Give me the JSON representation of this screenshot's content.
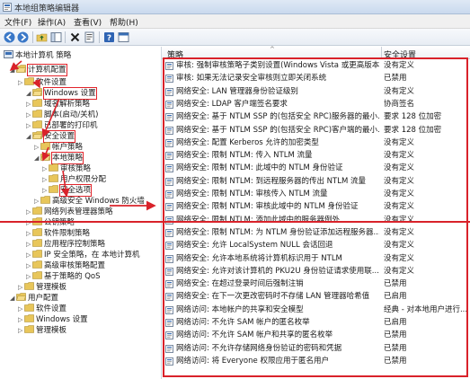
{
  "window": {
    "title": "本地组策略编辑器"
  },
  "menu": [
    "文件(F)",
    "操作(A)",
    "查看(V)",
    "帮助(H)"
  ],
  "toolbar": [
    "back-icon",
    "forward-icon",
    "up-folder-icon",
    "show-hide-tree-icon",
    "delete-icon",
    "properties-icon",
    "help-icon",
    "panel-icon"
  ],
  "tree": {
    "root": "本地计算机 策略",
    "nodes": [
      {
        "label": "计算机配置",
        "highlight": true
      },
      {
        "label": "软件设置"
      },
      {
        "label": "Windows 设置",
        "highlight": true
      },
      {
        "label": "域名解析策略"
      },
      {
        "label": "脚本(启动/关机)"
      },
      {
        "label": "已部署的打印机"
      },
      {
        "label": "安全设置",
        "highlight": true
      },
      {
        "label": "帐户策略"
      },
      {
        "label": "本地策略",
        "highlight": true
      },
      {
        "label": "审核策略"
      },
      {
        "label": "用户权限分配"
      },
      {
        "label": "安全选项",
        "highlight": true
      },
      {
        "label": "高级安全 Windows 防火墙"
      },
      {
        "label": "网络列表管理器策略"
      },
      {
        "label": "公钥策略"
      },
      {
        "label": "软件限制策略"
      },
      {
        "label": "应用程序控制策略"
      },
      {
        "label": "IP 安全策略，在 本地计算机"
      },
      {
        "label": "高级审核策略配置"
      },
      {
        "label": "基于策略的 QoS"
      },
      {
        "label": "管理模板"
      },
      {
        "label": "用户配置"
      },
      {
        "label": "软件设置"
      },
      {
        "label": "Windows 设置"
      },
      {
        "label": "管理模板"
      }
    ]
  },
  "list": {
    "col_policy": "策略",
    "col_setting": "安全设置",
    "rows": [
      {
        "name": "审核: 强制审核策略子类别设置(Windows Vista 或更高版本...",
        "value": "没有定义"
      },
      {
        "name": "审核: 如果无法记录安全审核则立即关闭系统",
        "value": "已禁用"
      },
      {
        "name": "网络安全: LAN 管理器身份验证级别",
        "value": "没有定义"
      },
      {
        "name": "网络安全: LDAP 客户端签名要求",
        "value": "协商签名"
      },
      {
        "name": "网络安全: 基于 NTLM SSP 的(包括安全 RPC)服务器的最小...",
        "value": "要求 128 位加密"
      },
      {
        "name": "网络安全: 基于 NTLM SSP 的(包括安全 RPC)客户端的最小...",
        "value": "要求 128 位加密"
      },
      {
        "name": "网络安全: 配置 Kerberos 允许的加密类型",
        "value": "没有定义"
      },
      {
        "name": "网络安全: 限制 NTLM: 传入 NTLM 流量",
        "value": "没有定义"
      },
      {
        "name": "网络安全: 限制 NTLM: 此域中的 NTLM 身份验证",
        "value": "没有定义"
      },
      {
        "name": "网络安全: 限制 NTLM: 到远程服务器的传出 NTLM 流量",
        "value": "没有定义"
      },
      {
        "name": "网络安全: 限制 NTLM: 审核传入 NTLM 流量",
        "value": "没有定义"
      },
      {
        "name": "网络安全: 限制 NTLM: 审核此域中的 NTLM 身份验证",
        "value": "没有定义"
      },
      {
        "name": "网络安全: 限制 NTLM: 添加此域中的服务器例外",
        "value": "没有定义"
      },
      {
        "name": "网络安全: 限制 NTLM: 为 NTLM 身份验证添加远程服务器...",
        "value": "没有定义"
      },
      {
        "name": "网络安全: 允许 LocalSystem NULL 会话回退",
        "value": "没有定义"
      },
      {
        "name": "网络安全: 允许本地系统将计算机标识用于 NTLM",
        "value": "没有定义"
      },
      {
        "name": "网络安全: 允许对该计算机的 PKU2U 身份验证请求使用联...",
        "value": "没有定义"
      },
      {
        "name": "网络安全: 在超过登录时间后强制注销",
        "value": "已禁用"
      },
      {
        "name": "网络安全: 在下一次更改密码时不存储 LAN 管理器哈希值",
        "value": "已启用"
      },
      {
        "name": "网络访问: 本地帐户的共享和安全模型",
        "value": "经典 - 对本地用户进行..."
      },
      {
        "name": "网络访问: 不允许 SAM 帐户的匿名枚举",
        "value": "已启用"
      },
      {
        "name": "网络访问: 不允许 SAM 帐户和共享的匿名枚举",
        "value": "已禁用"
      },
      {
        "name": "网络访问: 不允许存储网络身份验证的密码和凭据",
        "value": "已禁用"
      },
      {
        "name": "网络访问: 将 Everyone 权限应用于匿名用户",
        "value": "已禁用"
      }
    ]
  },
  "colors": {
    "annotation": "#d9222a",
    "folder": "#e8c65a",
    "accent": "#3a6fb5"
  }
}
